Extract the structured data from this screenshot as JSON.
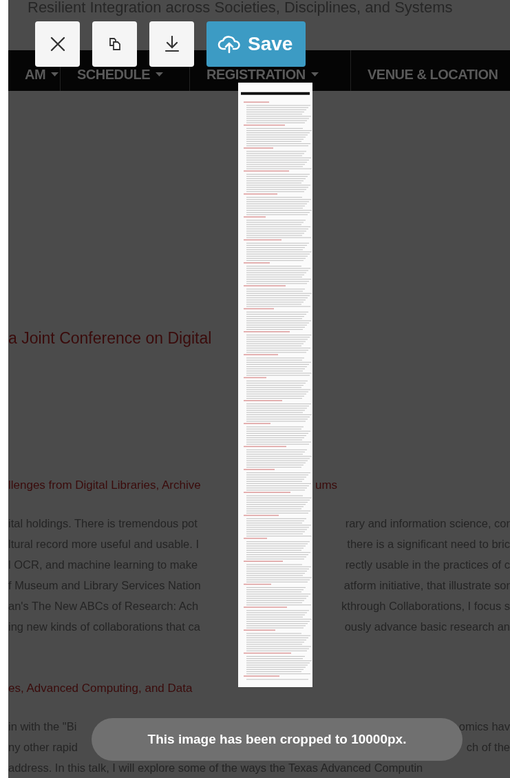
{
  "page_header": {
    "title": "Resilient Integration across Societies, Disciplines, and Systems"
  },
  "nav": [
    {
      "label": "AM",
      "dropdown": true
    },
    {
      "label": "SCHEDULE",
      "dropdown": true
    },
    {
      "label": "REGISTRATION",
      "dropdown": true
    },
    {
      "label": "VENUE & LOCATION",
      "dropdown": false
    }
  ],
  "content": [
    {
      "kind": "title",
      "left": "a Joint Conference on Digital"
    },
    {
      "kind": "subheading",
      "left": "llenges from Digital Libraries, Archive",
      "right": "ums"
    },
    {
      "kind": "text",
      "left": "ital holdings. There is tremendous pot",
      "right": "rary and information science, cor"
    },
    {
      "kind": "text",
      "left": "ltural record more useful and usable. I",
      "right": "there is a significant need to bric"
    },
    {
      "kind": "text",
      "left": "l OCR, and machine learning to make",
      "right": "rectly usable in the practices of c"
    },
    {
      "kind": "text",
      "left": "f Museum and Library Services Nation",
      "right": "atform initiative, that illustrate sor"
    },
    {
      "kind": "text",
      "left": "an's The New ABCs of Research: Ach",
      "right": "kthrough Collaborations, I focus s"
    },
    {
      "kind": "text",
      "left": "ing new kinds of collaborations that ca",
      "right": "ously advance basic research an"
    },
    {
      "kind": "subheading",
      "left": "es, Advanced Computing, and Data"
    },
    {
      "kind": "text",
      "left": "in with the \"Bi",
      "right": "omics hav"
    },
    {
      "kind": "text",
      "left": "ny other rapid",
      "right": "ch of the"
    },
    {
      "kind": "text",
      "left": "address. In this talk, I will explore some of the ways the Texas Advanced Computin"
    }
  ],
  "toolbar": {
    "buttons": [
      {
        "kind": "close"
      },
      {
        "kind": "copy"
      },
      {
        "kind": "download"
      },
      {
        "kind": "save",
        "label": "Save"
      }
    ]
  },
  "toast": "This image has been cropped to 10000px."
}
